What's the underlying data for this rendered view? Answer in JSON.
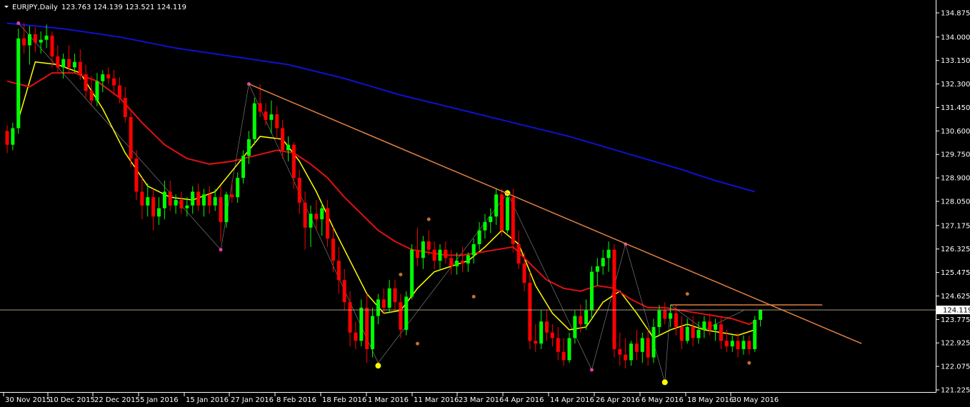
{
  "window": {
    "symbol_label": "EURJPY,Daily",
    "ohlc_text": "123.763 124.139 123.521 124.119"
  },
  "colors": {
    "background": "#000000",
    "bull": "#00ff00",
    "bear": "#ff0000",
    "ma_fast": "#ffff00",
    "ma_mid": "#e01010",
    "ma_slow": "#1010d0",
    "trendline": "#e08040",
    "zigzag": "#c8c8c8",
    "price_line": "#c0b090",
    "axis": "#ffffff"
  },
  "chart_data": {
    "type": "candlestick",
    "title": "EURJPY,Daily",
    "current_price": "124.119",
    "y_ticks": [
      "134.875",
      "134.000",
      "133.150",
      "132.300",
      "131.450",
      "130.600",
      "129.750",
      "128.900",
      "128.050",
      "127.175",
      "126.325",
      "125.475",
      "124.625",
      "123.775",
      "122.925",
      "122.075",
      "121.225"
    ],
    "ylim": [
      121.225,
      134.875
    ],
    "x_labels": [
      "30 Nov 2015",
      "10 Dec 2015",
      "22 Dec 2015",
      "5 Jan 2016",
      "15 Jan 2016",
      "27 Jan 2016",
      "8 Feb 2016",
      "18 Feb 2016",
      "1 Mar 2016",
      "11 Mar 2016",
      "23 Mar 2016",
      "4 Apr 2016",
      "14 Apr 2016",
      "26 Apr 2016",
      "6 May 2016",
      "18 May 2016",
      "30 May 2016"
    ],
    "candles": [
      [
        130.6,
        130.8,
        129.8,
        130.1
      ],
      [
        130.1,
        130.9,
        129.9,
        130.7
      ],
      [
        130.7,
        134.3,
        130.5,
        133.95
      ],
      [
        133.95,
        134.5,
        133.4,
        133.7
      ],
      [
        133.7,
        134.4,
        133.0,
        134.1
      ],
      [
        134.1,
        134.35,
        133.45,
        133.8
      ],
      [
        133.8,
        134.2,
        133.4,
        133.9
      ],
      [
        133.9,
        134.45,
        133.6,
        134.05
      ],
      [
        134.05,
        134.2,
        132.9,
        133.3
      ],
      [
        133.3,
        133.7,
        132.7,
        132.9
      ],
      [
        132.9,
        133.4,
        132.5,
        133.2
      ],
      [
        133.2,
        133.7,
        132.7,
        132.9
      ],
      [
        132.9,
        133.4,
        132.7,
        133.1
      ],
      [
        133.1,
        133.55,
        132.45,
        132.65
      ],
      [
        132.65,
        133.0,
        131.8,
        132.05
      ],
      [
        132.05,
        132.6,
        131.5,
        131.7
      ],
      [
        131.7,
        132.7,
        131.5,
        132.4
      ],
      [
        132.4,
        132.8,
        132.0,
        132.65
      ],
      [
        132.65,
        132.9,
        132.3,
        132.5
      ],
      [
        132.5,
        132.8,
        131.9,
        132.25
      ],
      [
        132.25,
        132.55,
        131.6,
        131.8
      ],
      [
        131.8,
        132.2,
        130.9,
        131.1
      ],
      [
        131.1,
        131.4,
        129.3,
        129.6
      ],
      [
        129.6,
        129.9,
        128.1,
        128.4
      ],
      [
        128.4,
        128.9,
        127.4,
        127.9
      ],
      [
        127.9,
        128.7,
        127.5,
        128.2
      ],
      [
        128.2,
        128.5,
        127.0,
        127.5
      ],
      [
        127.5,
        128.2,
        127.2,
        127.8
      ],
      [
        127.8,
        128.8,
        127.4,
        128.4
      ],
      [
        128.4,
        128.8,
        127.7,
        127.9
      ],
      [
        127.9,
        128.3,
        127.6,
        128.1
      ],
      [
        128.1,
        128.4,
        127.6,
        127.8
      ],
      [
        127.8,
        128.2,
        127.5,
        127.9
      ],
      [
        127.9,
        128.6,
        127.6,
        128.4
      ],
      [
        128.4,
        128.7,
        127.7,
        127.9
      ],
      [
        127.9,
        128.5,
        127.5,
        128.3
      ],
      [
        128.3,
        128.6,
        127.6,
        127.9
      ],
      [
        127.9,
        128.5,
        127.7,
        128.2
      ],
      [
        128.2,
        128.6,
        126.6,
        127.3
      ],
      [
        127.3,
        128.4,
        127.1,
        128.3
      ],
      [
        128.3,
        128.8,
        128.0,
        128.2
      ],
      [
        128.2,
        129.1,
        128.0,
        128.9
      ],
      [
        128.9,
        129.9,
        128.7,
        129.7
      ],
      [
        129.7,
        130.6,
        129.4,
        130.3
      ],
      [
        130.3,
        131.8,
        130.1,
        131.6
      ],
      [
        131.6,
        132.3,
        131.1,
        131.3
      ],
      [
        131.3,
        131.6,
        130.8,
        131.0
      ],
      [
        131.0,
        131.7,
        130.5,
        131.2
      ],
      [
        131.2,
        131.5,
        130.3,
        130.7
      ],
      [
        130.7,
        131.0,
        129.6,
        129.9
      ],
      [
        129.9,
        130.4,
        129.5,
        130.1
      ],
      [
        130.1,
        130.2,
        128.5,
        128.9
      ],
      [
        128.9,
        129.2,
        127.6,
        128.0
      ],
      [
        128.0,
        128.4,
        126.3,
        127.1
      ],
      [
        127.1,
        127.9,
        126.4,
        127.6
      ],
      [
        127.6,
        128.1,
        127.0,
        127.4
      ],
      [
        127.4,
        128.0,
        126.8,
        127.8
      ],
      [
        127.8,
        128.1,
        126.4,
        126.7
      ],
      [
        126.7,
        127.1,
        125.5,
        125.9
      ],
      [
        125.9,
        126.4,
        124.7,
        125.2
      ],
      [
        125.2,
        125.6,
        124.1,
        124.4
      ],
      [
        124.4,
        124.8,
        122.8,
        123.3
      ],
      [
        123.3,
        123.7,
        122.7,
        123.0
      ],
      [
        123.0,
        124.5,
        122.8,
        124.2
      ],
      [
        124.2,
        124.7,
        122.2,
        122.7
      ],
      [
        122.7,
        124.2,
        122.4,
        123.9
      ],
      [
        123.9,
        124.7,
        123.6,
        124.5
      ],
      [
        124.5,
        124.9,
        124.0,
        124.2
      ],
      [
        124.2,
        125.2,
        124.0,
        124.9
      ],
      [
        124.9,
        125.2,
        124.1,
        124.4
      ],
      [
        124.4,
        124.7,
        123.1,
        123.4
      ],
      [
        123.4,
        124.8,
        123.2,
        124.6
      ],
      [
        124.6,
        126.5,
        124.5,
        126.3
      ],
      [
        126.3,
        127.1,
        125.7,
        126.0
      ],
      [
        126.0,
        126.8,
        125.6,
        126.6
      ],
      [
        126.6,
        127.0,
        126.1,
        126.3
      ],
      [
        126.3,
        126.6,
        125.6,
        125.9
      ],
      [
        125.9,
        126.5,
        125.6,
        126.3
      ],
      [
        126.3,
        126.6,
        125.8,
        126.0
      ],
      [
        126.0,
        126.3,
        125.4,
        125.7
      ],
      [
        125.7,
        126.2,
        125.4,
        125.9
      ],
      [
        125.9,
        126.4,
        125.5,
        125.8
      ],
      [
        125.8,
        126.2,
        125.5,
        126.1
      ],
      [
        126.1,
        126.7,
        125.8,
        126.5
      ],
      [
        126.5,
        127.3,
        126.3,
        127.0
      ],
      [
        127.0,
        127.6,
        126.7,
        127.3
      ],
      [
        127.3,
        127.8,
        126.9,
        127.5
      ],
      [
        127.5,
        128.5,
        127.2,
        128.3
      ],
      [
        128.3,
        128.5,
        126.8,
        127.0
      ],
      [
        127.0,
        128.4,
        126.9,
        128.2
      ],
      [
        128.2,
        128.5,
        126.2,
        126.5
      ],
      [
        126.5,
        127.0,
        125.6,
        125.8
      ],
      [
        125.8,
        126.2,
        124.8,
        125.1
      ],
      [
        125.1,
        125.5,
        122.7,
        123.0
      ],
      [
        123.0,
        123.6,
        122.6,
        122.9
      ],
      [
        122.9,
        124.1,
        122.7,
        123.7
      ],
      [
        123.7,
        124.1,
        123.0,
        123.3
      ],
      [
        123.3,
        123.6,
        122.8,
        123.1
      ],
      [
        123.1,
        123.5,
        122.3,
        122.6
      ],
      [
        122.6,
        123.1,
        122.1,
        122.3
      ],
      [
        122.3,
        123.3,
        122.2,
        123.1
      ],
      [
        123.1,
        124.1,
        122.9,
        123.9
      ],
      [
        123.9,
        124.3,
        123.3,
        123.6
      ],
      [
        123.6,
        124.5,
        123.4,
        124.1
      ],
      [
        124.1,
        125.7,
        123.8,
        125.5
      ],
      [
        125.5,
        126.0,
        125.0,
        125.7
      ],
      [
        125.7,
        126.3,
        125.4,
        126.0
      ],
      [
        126.0,
        126.6,
        125.5,
        126.3
      ],
      [
        126.3,
        126.5,
        122.4,
        122.7
      ],
      [
        122.7,
        123.3,
        122.1,
        122.5
      ],
      [
        122.5,
        123.1,
        122.0,
        122.3
      ],
      [
        122.3,
        123.0,
        122.1,
        122.9
      ],
      [
        122.9,
        123.4,
        122.3,
        122.6
      ],
      [
        122.6,
        123.3,
        122.2,
        123.1
      ],
      [
        123.1,
        123.4,
        122.1,
        122.4
      ],
      [
        122.4,
        123.8,
        122.2,
        123.5
      ],
      [
        123.5,
        124.3,
        123.2,
        124.1
      ],
      [
        124.1,
        124.4,
        123.6,
        123.8
      ],
      [
        123.8,
        124.3,
        123.5,
        124.0
      ],
      [
        124.0,
        124.3,
        123.2,
        123.5
      ],
      [
        123.5,
        123.9,
        122.7,
        123.0
      ],
      [
        123.0,
        123.8,
        122.9,
        123.5
      ],
      [
        123.5,
        123.9,
        122.8,
        123.1
      ],
      [
        123.1,
        123.7,
        122.9,
        123.4
      ],
      [
        123.4,
        123.9,
        123.1,
        123.7
      ],
      [
        123.7,
        124.0,
        123.2,
        123.4
      ],
      [
        123.4,
        123.8,
        123.0,
        123.6
      ],
      [
        123.6,
        123.9,
        122.7,
        123.0
      ],
      [
        123.0,
        123.4,
        122.6,
        122.8
      ],
      [
        122.8,
        123.2,
        122.6,
        123.0
      ],
      [
        123.0,
        123.3,
        122.4,
        122.7
      ],
      [
        122.7,
        123.2,
        122.5,
        123.0
      ],
      [
        123.0,
        123.2,
        122.5,
        122.7
      ],
      [
        122.7,
        123.9,
        122.6,
        123.76
      ],
      [
        123.76,
        124.14,
        123.52,
        124.12
      ]
    ],
    "series": [
      {
        "name": "",
        "type": "ma",
        "color": "#ffff00",
        "points": [
          [
            2,
            131.0
          ],
          [
            5,
            133.1
          ],
          [
            9,
            133.0
          ],
          [
            13,
            132.7
          ],
          [
            17,
            131.4
          ],
          [
            21,
            129.8
          ],
          [
            25,
            128.6
          ],
          [
            29,
            128.2
          ],
          [
            33,
            128.1
          ],
          [
            37,
            128.4
          ],
          [
            41,
            129.4
          ],
          [
            45,
            130.4
          ],
          [
            49,
            130.3
          ],
          [
            52,
            129.5
          ],
          [
            55,
            128.4
          ],
          [
            58,
            127.1
          ],
          [
            61,
            125.9
          ],
          [
            64,
            124.7
          ],
          [
            67,
            124.0
          ],
          [
            70,
            124.1
          ],
          [
            73,
            124.9
          ],
          [
            76,
            125.5
          ],
          [
            79,
            125.7
          ],
          [
            82,
            125.9
          ],
          [
            85,
            126.4
          ],
          [
            88,
            127.0
          ],
          [
            91,
            126.5
          ],
          [
            94,
            125.0
          ],
          [
            97,
            124.0
          ],
          [
            100,
            123.4
          ],
          [
            103,
            123.5
          ],
          [
            106,
            124.4
          ],
          [
            109,
            124.8
          ],
          [
            112,
            124.0
          ],
          [
            115,
            123.1
          ],
          [
            118,
            123.4
          ],
          [
            121,
            123.6
          ],
          [
            124,
            123.4
          ],
          [
            127,
            123.3
          ],
          [
            130,
            123.2
          ],
          [
            133,
            123.4
          ]
        ]
      },
      {
        "name": "",
        "type": "ma",
        "color": "#e01010",
        "points": [
          [
            0,
            132.4
          ],
          [
            4,
            132.2
          ],
          [
            8,
            132.7
          ],
          [
            12,
            132.7
          ],
          [
            16,
            132.4
          ],
          [
            20,
            131.8
          ],
          [
            24,
            130.9
          ],
          [
            28,
            130.1
          ],
          [
            32,
            129.6
          ],
          [
            36,
            129.4
          ],
          [
            40,
            129.5
          ],
          [
            44,
            129.7
          ],
          [
            48,
            129.9
          ],
          [
            51,
            129.8
          ],
          [
            54,
            129.4
          ],
          [
            57,
            128.9
          ],
          [
            60,
            128.2
          ],
          [
            63,
            127.6
          ],
          [
            66,
            127.0
          ],
          [
            69,
            126.6
          ],
          [
            72,
            126.3
          ],
          [
            75,
            126.2
          ],
          [
            78,
            126.1
          ],
          [
            81,
            126.1
          ],
          [
            84,
            126.2
          ],
          [
            87,
            126.3
          ],
          [
            90,
            126.4
          ],
          [
            93,
            125.8
          ],
          [
            96,
            125.2
          ],
          [
            99,
            124.9
          ],
          [
            102,
            124.8
          ],
          [
            105,
            125.0
          ],
          [
            108,
            124.9
          ],
          [
            111,
            124.5
          ],
          [
            114,
            124.2
          ],
          [
            117,
            124.2
          ],
          [
            120,
            124.1
          ],
          [
            123,
            124.0
          ],
          [
            126,
            123.9
          ],
          [
            129,
            123.8
          ],
          [
            132,
            123.6
          ],
          [
            133,
            123.7
          ]
        ]
      },
      {
        "name": "",
        "type": "ma",
        "color": "#1010d0",
        "points": [
          [
            0,
            134.5
          ],
          [
            10,
            134.3
          ],
          [
            20,
            134.0
          ],
          [
            30,
            133.6
          ],
          [
            40,
            133.3
          ],
          [
            50,
            133.0
          ],
          [
            60,
            132.5
          ],
          [
            70,
            131.9
          ],
          [
            80,
            131.4
          ],
          [
            90,
            130.9
          ],
          [
            100,
            130.4
          ],
          [
            110,
            129.8
          ],
          [
            120,
            129.2
          ],
          [
            126,
            128.8
          ],
          [
            133,
            128.4
          ]
        ]
      }
    ],
    "zigzag": [
      [
        2,
        134.5
      ],
      [
        38,
        126.3
      ],
      [
        43,
        132.3
      ],
      [
        66,
        122.2
      ],
      [
        89,
        128.35
      ],
      [
        104,
        121.95
      ],
      [
        110,
        126.5
      ],
      [
        117,
        121.5
      ],
      [
        118,
        124.3
      ],
      [
        124,
        123.4
      ],
      [
        131,
        124.1
      ]
    ],
    "zigzag_markers": [
      {
        "i": 2,
        "v": 134.5,
        "color": "#e040a0"
      },
      {
        "i": 38,
        "v": 126.3,
        "color": "#e040a0"
      },
      {
        "i": 43,
        "v": 132.3,
        "color": "#e040a0"
      },
      {
        "i": 66,
        "v": 122.1,
        "color": "#ffff00"
      },
      {
        "i": 89,
        "v": 128.35,
        "color": "#ffff00"
      },
      {
        "i": 104,
        "v": 121.95,
        "color": "#e040a0"
      },
      {
        "i": 110,
        "v": 126.5,
        "color": "#e040a0"
      },
      {
        "i": 117,
        "v": 121.5,
        "color": "#ffff00"
      },
      {
        "i": 70,
        "v": 125.4,
        "color": "#c07030"
      },
      {
        "i": 73,
        "v": 122.9,
        "color": "#c07030"
      },
      {
        "i": 75,
        "v": 127.4,
        "color": "#c07030"
      },
      {
        "i": 83,
        "v": 124.6,
        "color": "#c07030"
      },
      {
        "i": 121,
        "v": 124.7,
        "color": "#c07030"
      },
      {
        "i": 132,
        "v": 122.2,
        "color": "#c07030"
      }
    ],
    "trendline": [
      [
        43,
        132.3
      ],
      [
        152,
        122.9
      ]
    ],
    "resistance": {
      "from": 118,
      "to": 145,
      "v": 124.3
    },
    "grid": false
  }
}
